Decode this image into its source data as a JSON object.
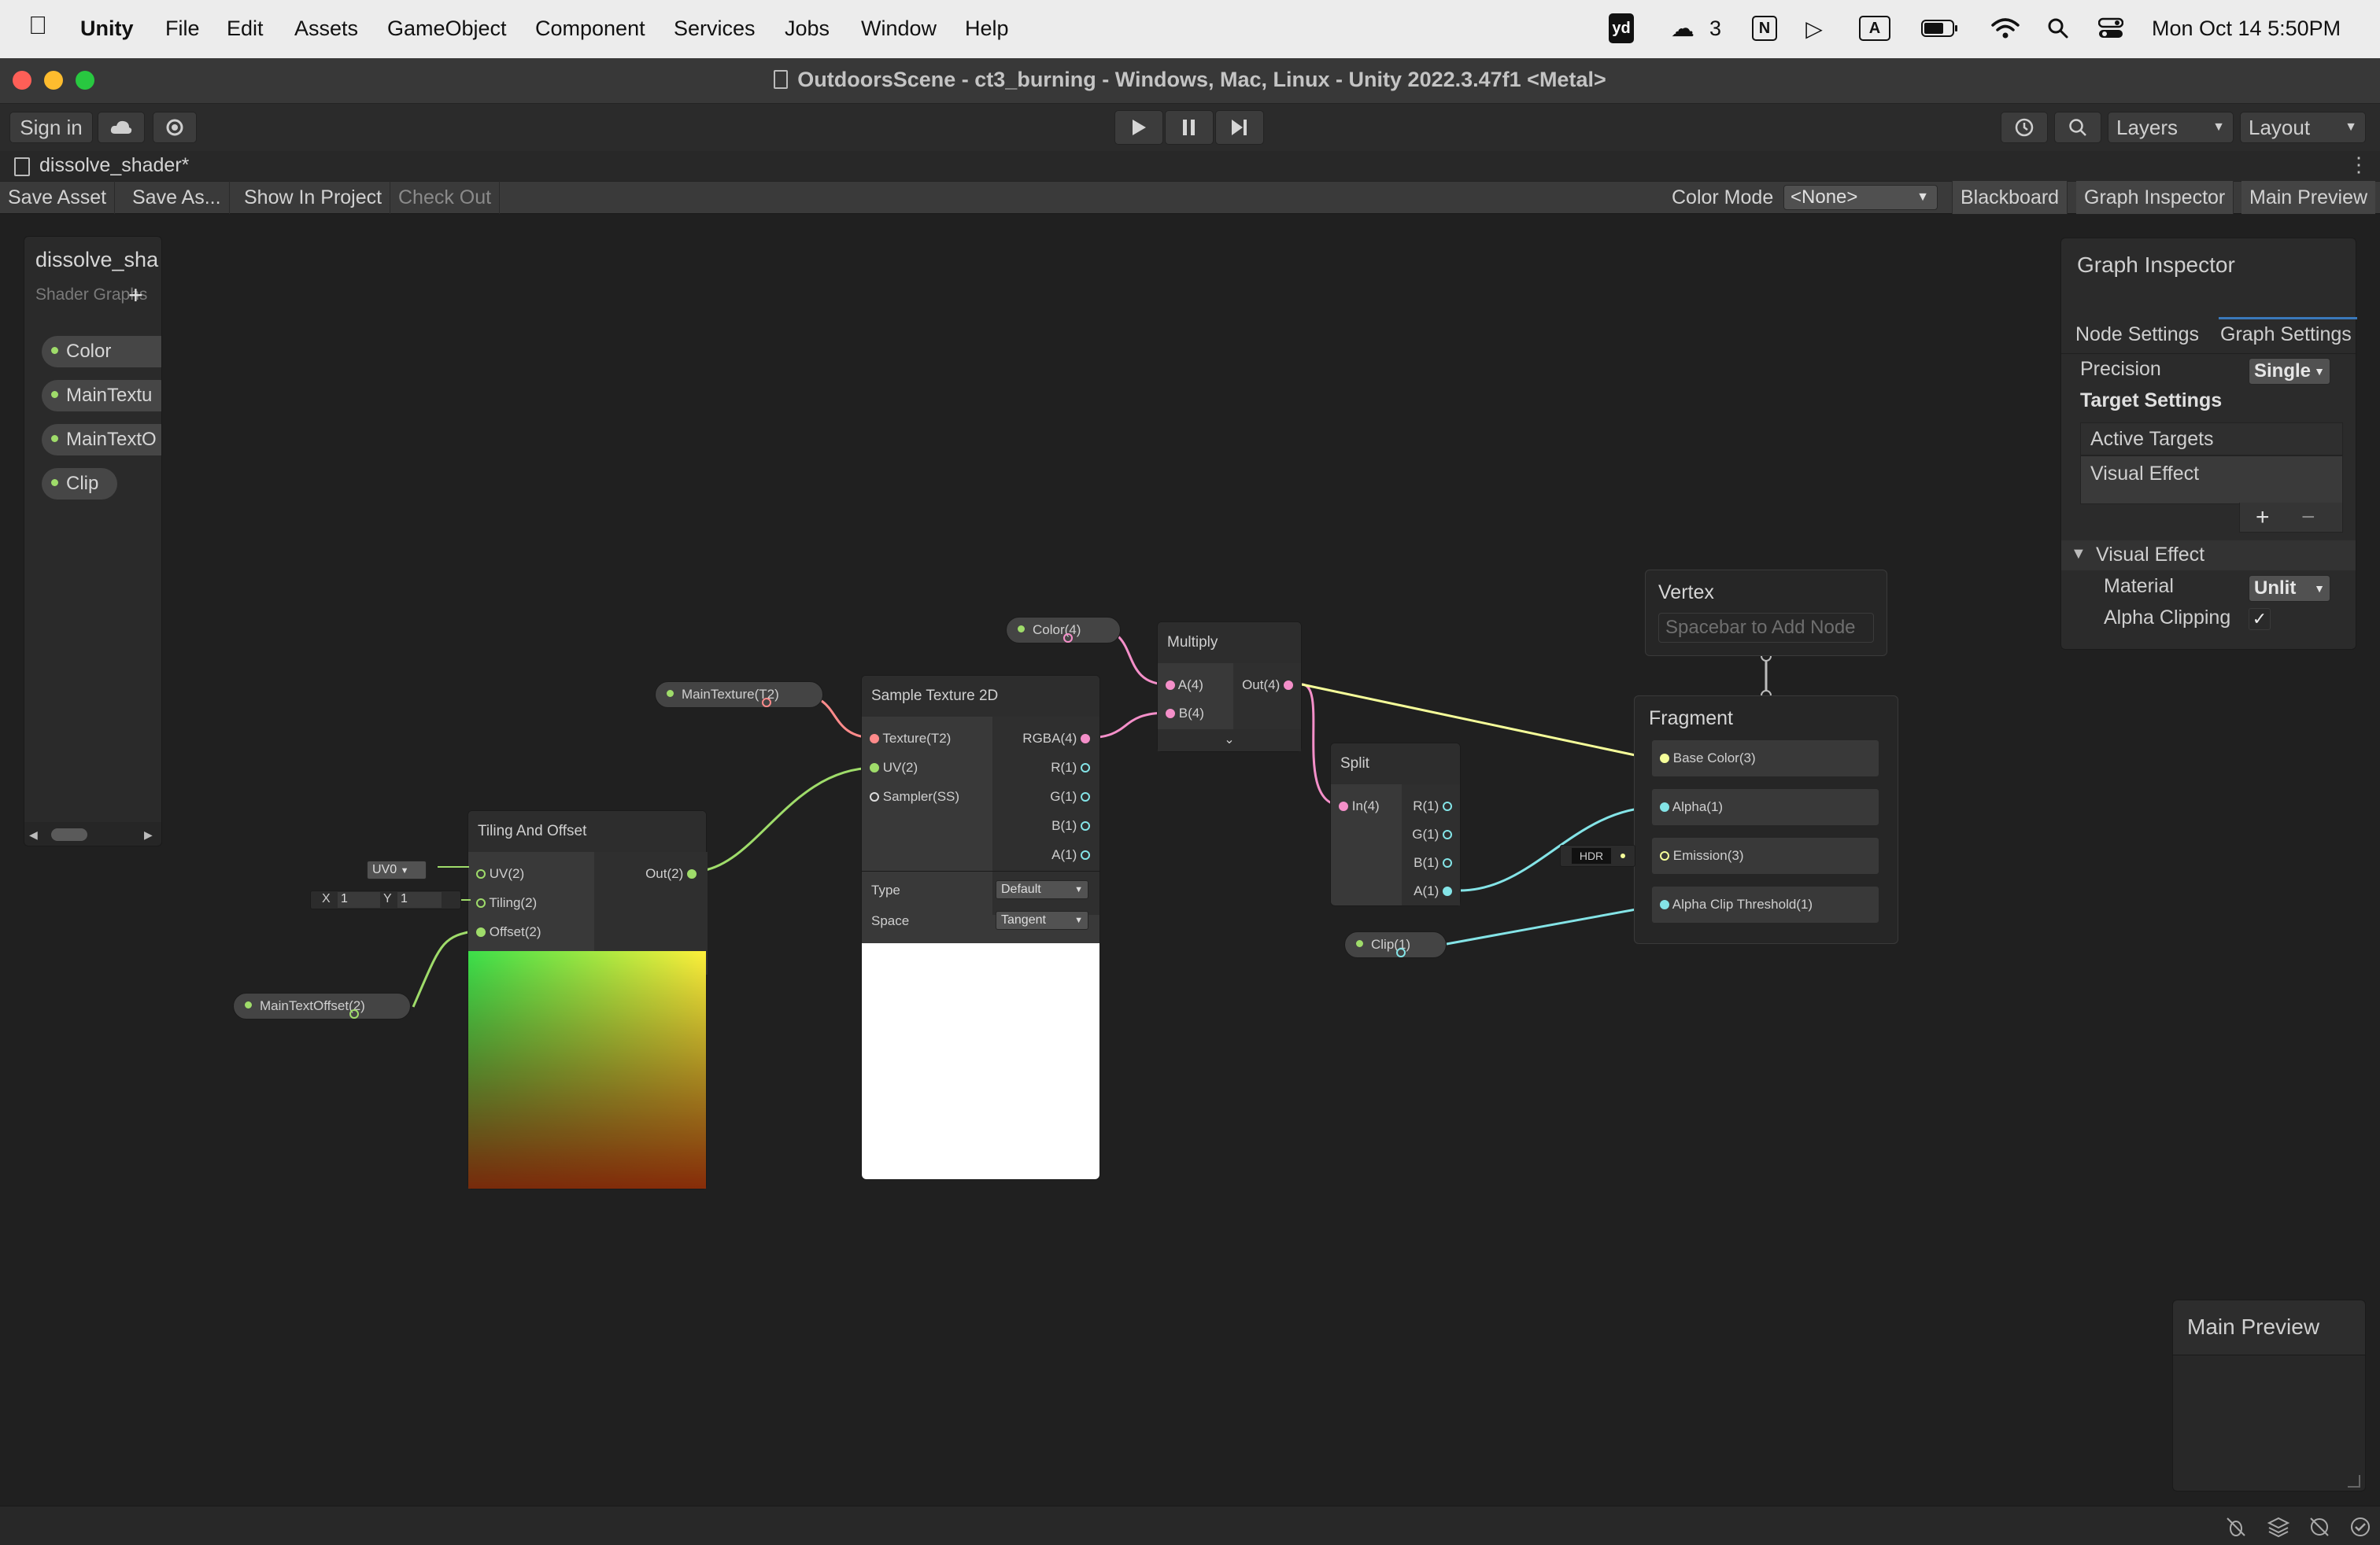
{
  "menubar": {
    "app": "Unity",
    "items": [
      "File",
      "Edit",
      "Assets",
      "GameObject",
      "Component",
      "Services",
      "Jobs",
      "Window",
      "Help"
    ],
    "status": {
      "yd": "yd",
      "wechat_count": "3",
      "n": "N",
      "a": "A",
      "datetime": "Mon Oct 14  5:50PM"
    }
  },
  "window": {
    "title": "OutdoorsScene - ct3_burning - Windows, Mac, Linux - Unity 2022.3.47f1 <Metal>"
  },
  "toolbar": {
    "sign_in": "Sign in",
    "layers": "Layers",
    "layout": "Layout"
  },
  "tab": {
    "title": "dissolve_shader*"
  },
  "graph_toolbar": {
    "save_asset": "Save Asset",
    "save_as": "Save As...",
    "show_in_project": "Show In Project",
    "check_out": "Check Out",
    "color_mode_label": "Color Mode",
    "color_mode_value": "<None>",
    "blackboard": "Blackboard",
    "graph_inspector": "Graph Inspector",
    "main_preview": "Main Preview"
  },
  "blackboard": {
    "title": "dissolve_sha",
    "subtitle": "Shader Graphs",
    "properties": [
      {
        "label": "Color",
        "color": "#9fdc6a"
      },
      {
        "label": "MainTextu",
        "color": "#9fdc6a"
      },
      {
        "label": "MainTextO",
        "color": "#9fdc6a"
      },
      {
        "label": "Clip",
        "color": "#9fdc6a"
      }
    ]
  },
  "nodes": {
    "tiling": {
      "title": "Tiling And Offset",
      "uv": "UV(2)",
      "tiling": "Tiling(2)",
      "offset": "Offset(2)",
      "out": "Out(2)",
      "uv_select": "UV0",
      "x_label": "X",
      "x_val": "1",
      "y_label": "Y",
      "y_val": "1"
    },
    "sample": {
      "title": "Sample Texture 2D",
      "texture": "Texture(T2)",
      "uv": "UV(2)",
      "sampler": "Sampler(SS)",
      "rgba": "RGBA(4)",
      "r": "R(1)",
      "g": "G(1)",
      "b": "B(1)",
      "a": "A(1)",
      "type_label": "Type",
      "type_val": "Default",
      "space_label": "Space",
      "space_val": "Tangent"
    },
    "multiply": {
      "title": "Multiply",
      "a": "A(4)",
      "b": "B(4)",
      "out": "Out(4)"
    },
    "split": {
      "title": "Split",
      "in": "In(4)",
      "r": "R(1)",
      "g": "G(1)",
      "b": "B(1)",
      "a": "A(1)"
    },
    "vertex": {
      "title": "Vertex",
      "hint": "Spacebar to Add Node"
    },
    "fragment": {
      "title": "Fragment",
      "base_color": "Base Color(3)",
      "alpha": "Alpha(1)",
      "emission": "Emission(3)",
      "alpha_clip": "Alpha Clip Threshold(1)",
      "hdr": "HDR"
    },
    "props": {
      "color": "Color(4)",
      "main_texture": "MainTexture(T2)",
      "main_offset": "MainTextOffset(2)",
      "clip": "Clip(1)"
    }
  },
  "inspector": {
    "title": "Graph Inspector",
    "tab_node": "Node Settings",
    "tab_graph": "Graph Settings",
    "precision_label": "Precision",
    "precision_val": "Single",
    "target_settings": "Target Settings",
    "active_targets": "Active Targets",
    "target_item": "Visual Effect",
    "plus": "+",
    "minus": "−",
    "section": "Visual Effect",
    "material_label": "Material",
    "material_val": "Unlit",
    "alpha_clip_label": "Alpha Clipping",
    "alpha_clip_checked": "✓"
  },
  "main_preview": {
    "title": "Main Preview"
  },
  "colors": {
    "vec4": "#f48fc9",
    "vec2": "#9fdc6a",
    "vec1": "#84e4e7",
    "vec3": "#f6ff9a",
    "tex": "#ff8b8b",
    "accent": "#3a79bb"
  }
}
